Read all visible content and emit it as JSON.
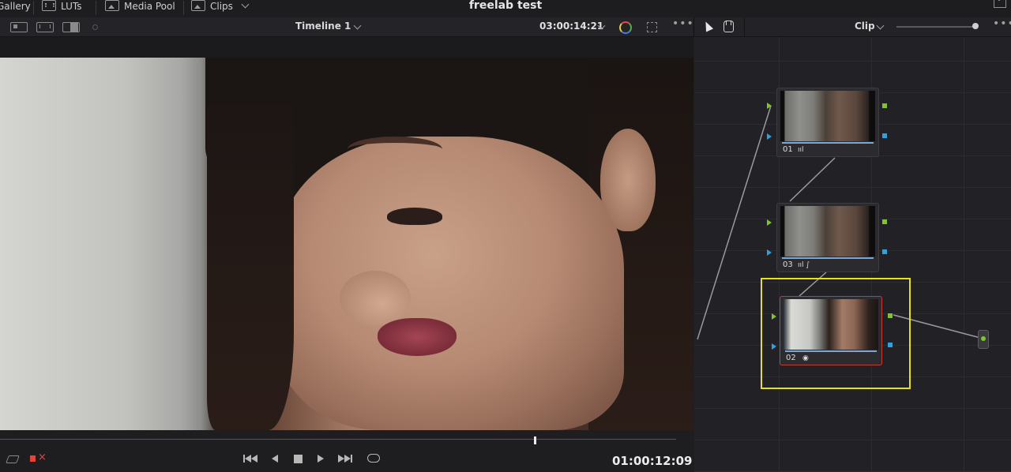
{
  "topbar": {
    "gallery_label": "Gallery",
    "luts_label": "LUTs",
    "media_pool_label": "Media Pool",
    "clips_label": "Clips",
    "project_title": "freelab test"
  },
  "viewer": {
    "timeline_name": "Timeline 1",
    "timecode_source": "03:00:14:21",
    "timecode_record": "01:00:12:09",
    "playhead_fraction": 0.79
  },
  "node_editor": {
    "mode_label": "Clip",
    "nodes": [
      {
        "label": "01",
        "icons": "ııl",
        "selected": false
      },
      {
        "label": "03",
        "icons": "ııl ∫",
        "selected": false
      },
      {
        "label": "02",
        "icons": "◉",
        "selected": true
      }
    ]
  },
  "colors": {
    "selection_outline": "#e6e01e",
    "selected_node_border": "#c93a30",
    "port_rgb": "#7fc62a",
    "port_alpha": "#2aa3e0",
    "mute_icon": "#e2463a"
  }
}
